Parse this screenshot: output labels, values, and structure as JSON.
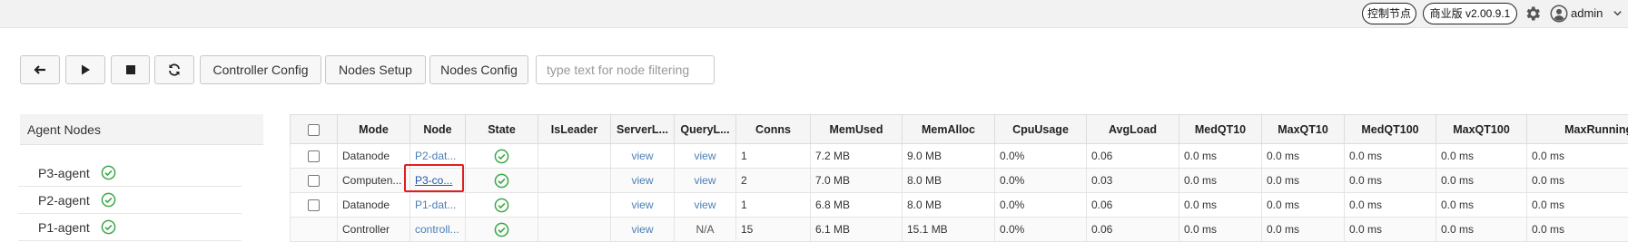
{
  "topbar": {
    "control_node_label": "控制节点",
    "version_label": "商业版 v2.00.9.1",
    "user_name": "admin"
  },
  "toolbar": {
    "controller_config_label": "Controller Config",
    "nodes_setup_label": "Nodes Setup",
    "nodes_config_label": "Nodes Config",
    "filter_placeholder": "type text for node filtering",
    "icons": [
      "arrow-left-icon",
      "play-icon",
      "stop-icon",
      "refresh-icon"
    ]
  },
  "agent_panel": {
    "title": "Agent Nodes",
    "items": [
      {
        "label": "P3-agent",
        "status": "ok"
      },
      {
        "label": "P2-agent",
        "status": "ok"
      },
      {
        "label": "P1-agent",
        "status": "ok"
      }
    ]
  },
  "table": {
    "columns": [
      "",
      "Mode",
      "Node",
      "State",
      "IsLeader",
      "ServerL...",
      "QueryL...",
      "Conns",
      "MemUsed",
      "MemAlloc",
      "CpuUsage",
      "AvgLoad",
      "MedQT10",
      "MaxQT10",
      "MedQT100",
      "MaxQT100",
      "MaxRunningQ"
    ],
    "rows": [
      {
        "mode": "Datanode",
        "node": "P2-dat...",
        "state": "ok",
        "is_leader": "",
        "server_log": "view",
        "query_log": "view",
        "conns": "1",
        "mem_used": "7.2 MB",
        "mem_alloc": "9.0 MB",
        "cpu": "0.0%",
        "avg_load": "0.06",
        "med_qt10": "0.0 ms",
        "max_qt10": "0.0 ms",
        "med_qt100": "0.0 ms",
        "max_qt100": "0.0 ms",
        "max_running": "0.0 ms"
      },
      {
        "mode": "Computen...",
        "node": "P3-co...",
        "state": "ok",
        "is_leader": "",
        "server_log": "view",
        "query_log": "view",
        "conns": "2",
        "mem_used": "7.0 MB",
        "mem_alloc": "8.0 MB",
        "cpu": "0.0%",
        "avg_load": "0.03",
        "med_qt10": "0.0 ms",
        "max_qt10": "0.0 ms",
        "med_qt100": "0.0 ms",
        "max_qt100": "0.0 ms",
        "max_running": "0.0 ms"
      },
      {
        "mode": "Datanode",
        "node": "P1-dat...",
        "state": "ok",
        "is_leader": "",
        "server_log": "view",
        "query_log": "view",
        "conns": "1",
        "mem_used": "6.8 MB",
        "mem_alloc": "8.0 MB",
        "cpu": "0.0%",
        "avg_load": "0.06",
        "med_qt10": "0.0 ms",
        "max_qt10": "0.0 ms",
        "med_qt100": "0.0 ms",
        "max_qt100": "0.0 ms",
        "max_running": "0.0 ms"
      },
      {
        "mode": "Controller",
        "node": "controll...",
        "state": "ok",
        "is_leader": "",
        "server_log": "view",
        "query_log": "N/A",
        "conns": "15",
        "mem_used": "6.1 MB",
        "mem_alloc": "15.1 MB",
        "cpu": "0.0%",
        "avg_load": "0.06",
        "med_qt10": "0.0 ms",
        "max_qt10": "0.0 ms",
        "med_qt100": "0.0 ms",
        "max_qt100": "0.0 ms",
        "max_running": "0.0 ms"
      }
    ]
  },
  "colors": {
    "link": "#4a7fb5",
    "ok_green": "#3aa845",
    "highlight": "#e02020"
  }
}
